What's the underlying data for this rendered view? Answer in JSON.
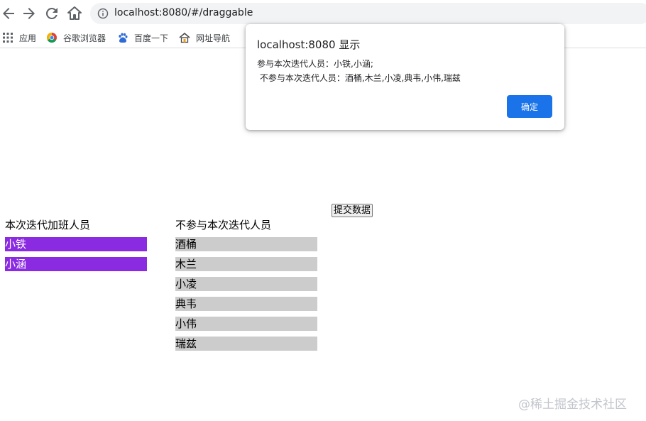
{
  "browser": {
    "url": "localhost:8080/#/draggable",
    "bookmarks": [
      "应用",
      "谷歌浏览器",
      "百度一下",
      "网址导航"
    ]
  },
  "page": {
    "submit_label": "提交数据",
    "in_title": "本次迭代加班人员",
    "in_members": [
      "小铁",
      "小涵"
    ],
    "out_title": "不参与本次迭代人员",
    "out_members": [
      "酒桶",
      "木兰",
      "小凌",
      "典韦",
      "小伟",
      "瑞兹"
    ],
    "in_color": "#8a2be2",
    "out_color": "#cccccc"
  },
  "dialog": {
    "title": "localhost:8080 显示",
    "line1": "参与本次迭代人员：小铁,小涵;",
    "line2": " 不参与本次迭代人员：酒桶,木兰,小凌,典韦,小伟,瑞兹",
    "ok_label": "确定"
  },
  "watermark": "@稀土掘金技术社区"
}
